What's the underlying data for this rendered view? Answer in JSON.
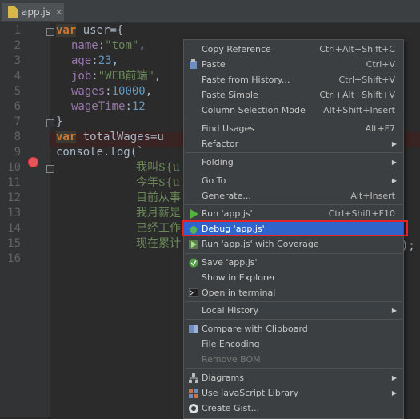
{
  "tab": {
    "filename": "app.js"
  },
  "line_numbers": [
    "1",
    "2",
    "3",
    "4",
    "5",
    "6",
    "7",
    "8",
    "9",
    "10",
    "11",
    "12",
    "13",
    "14",
    "15",
    "16"
  ],
  "code": {
    "l1_kw": "var",
    "l1_rest": " user={",
    "l2_prop": "name",
    "l2_colon": ":",
    "l2_str": "\"tom\"",
    "l2_end": ",",
    "l3_prop": "age",
    "l3_colon": ":",
    "l3_num": "23",
    "l3_end": ",",
    "l4_prop": "job",
    "l4_colon": ":",
    "l4_str": "\"WEB前端\"",
    "l4_end": ",",
    "l5_prop": "wages",
    "l5_colon": ":",
    "l5_num": "10000",
    "l5_end": ",",
    "l6_prop": "wageTime",
    "l6_colon": ":",
    "l6_num": "12",
    "l7": "}",
    "l8_kw": "var",
    "l8_rest": " totalWages=u",
    "l9": "console.log(`",
    "l10": "我叫${u",
    "l11": "今年${u",
    "l12": "目前从事",
    "l13": "我月薪是",
    "l14": "已经工作",
    "l15": "现在累计",
    "l15_tail": ");"
  },
  "menu": {
    "items": [
      {
        "label": "Copy Reference",
        "shortcut": "Ctrl+Alt+Shift+C"
      },
      {
        "label": "Paste",
        "shortcut": "Ctrl+V",
        "icon": "paste-icon"
      },
      {
        "label": "Paste from History...",
        "shortcut": "Ctrl+Shift+V"
      },
      {
        "label": "Paste Simple",
        "shortcut": "Ctrl+Alt+Shift+V"
      },
      {
        "label": "Column Selection Mode",
        "shortcut": "Alt+Shift+Insert"
      },
      {
        "label": "Find Usages",
        "shortcut": "Alt+F7"
      },
      {
        "label": "Refactor",
        "submenu": true
      },
      {
        "label": "Folding",
        "submenu": true
      },
      {
        "label": "Go To",
        "submenu": true
      },
      {
        "label": "Generate...",
        "shortcut": "Alt+Insert"
      },
      {
        "label": "Run 'app.js'",
        "shortcut": "Ctrl+Shift+F10",
        "icon": "run-icon"
      },
      {
        "label": "Debug 'app.js'",
        "icon": "debug-icon",
        "active": true
      },
      {
        "label": "Run 'app.js' with Coverage",
        "icon": "coverage-icon"
      },
      {
        "label": "Save 'app.js'",
        "icon": "save-icon"
      },
      {
        "label": "Show in Explorer"
      },
      {
        "label": "Open in terminal",
        "icon": "terminal-icon"
      },
      {
        "label": "Local History",
        "submenu": true
      },
      {
        "label": "Compare with Clipboard",
        "icon": "compare-icon"
      },
      {
        "label": "File Encoding"
      },
      {
        "label": "Remove BOM",
        "disabled": true
      },
      {
        "label": "Diagrams",
        "submenu": true,
        "icon": "diagrams-icon"
      },
      {
        "label": "Use JavaScript Library",
        "submenu": true,
        "icon": "library-icon"
      },
      {
        "label": "Create Gist...",
        "icon": "github-icon"
      }
    ]
  },
  "colors": {
    "accent": "#2f65ca",
    "highlight_box": "#e0242a",
    "breakpoint": "#e9545a"
  }
}
